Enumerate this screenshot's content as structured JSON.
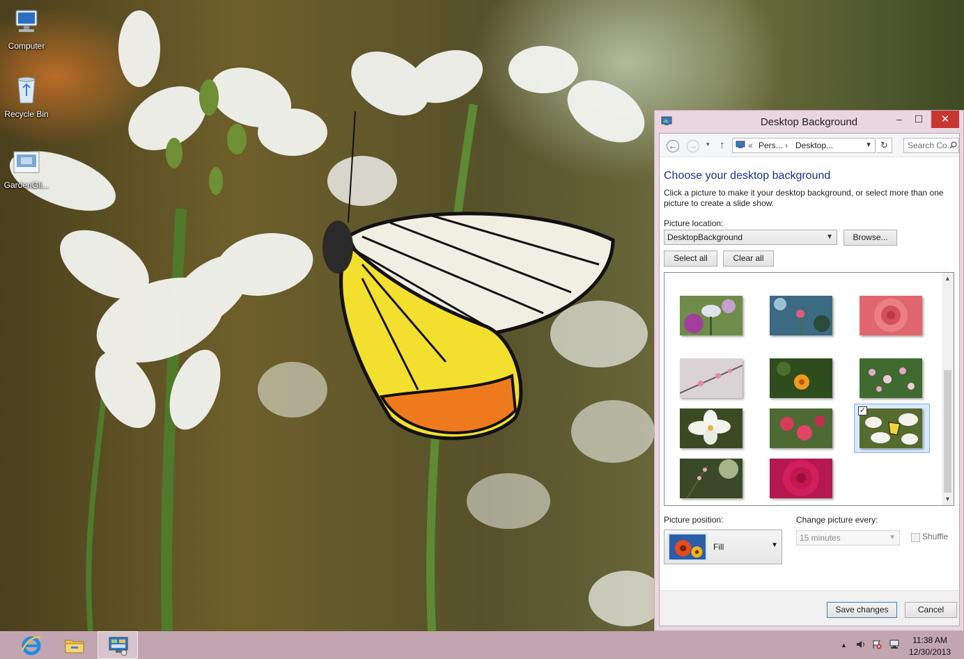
{
  "desktop": {
    "icons": [
      {
        "label": "Computer",
        "icon": "computer-icon"
      },
      {
        "label": "Recycle Bin",
        "icon": "recycle-bin-icon"
      },
      {
        "label": "GardenGli...",
        "icon": "theme-file-icon"
      }
    ]
  },
  "window": {
    "title": "Desktop Background",
    "controls": {
      "minimize": "–",
      "maximize": "☐",
      "close": "✕"
    },
    "nav": {
      "back": "←",
      "forward": "→",
      "recent": "▾",
      "up": "↑",
      "breadcrumb": [
        "Pers...",
        "Desktop..."
      ],
      "breadcrumb_sep": "«",
      "crumb_arrow": "›",
      "search_placeholder": "Search Co...",
      "refresh": "↻"
    },
    "heading": "Choose your desktop background",
    "description": "Click a picture to make it your desktop background, or select more than one picture to create a slide show.",
    "picture_location": {
      "label": "Picture location:",
      "value": "DesktopBackground",
      "browse_label": "Browse..."
    },
    "select_all_label": "Select all",
    "clear_all_label": "Clear all",
    "gallery": {
      "thumbnails": [
        {
          "subject": "butterfly on purple flowers",
          "selected": false
        },
        {
          "subject": "pink flower on blue bokeh",
          "selected": false
        },
        {
          "subject": "pink rose",
          "selected": false
        },
        {
          "subject": "branch with pink blossoms",
          "selected": false
        },
        {
          "subject": "orange flower on green",
          "selected": false
        },
        {
          "subject": "pink wildflowers",
          "selected": false
        },
        {
          "subject": "white lily",
          "selected": false
        },
        {
          "subject": "red gerbera flowers",
          "selected": false
        },
        {
          "subject": "butterfly on white flowers",
          "selected": true
        },
        {
          "subject": "small pink blossoms",
          "selected": false
        },
        {
          "subject": "magenta dahlia",
          "selected": false
        }
      ],
      "scroll_position": 0.55
    },
    "picture_position": {
      "label": "Picture position:",
      "value": "Fill"
    },
    "change_picture": {
      "label": "Change picture every:",
      "value": "15 minutes",
      "enabled": false
    },
    "shuffle": {
      "label": "Shuffle",
      "checked": false,
      "enabled": false
    },
    "save_label": "Save changes",
    "cancel_label": "Cancel"
  },
  "taskbar": {
    "apps": [
      {
        "name": "internet-explorer-icon",
        "active": false
      },
      {
        "name": "file-explorer-icon",
        "active": false
      },
      {
        "name": "control-panel-icon",
        "active": true
      }
    ],
    "tray": {
      "chevron": "▲"
    },
    "clock": {
      "time": "11:38 AM",
      "date": "12/30/2013"
    }
  },
  "colors": {
    "heading_blue": "#1e3287",
    "window_frame": "#ead6e0",
    "close_red": "#c7372f",
    "taskbar": "#cdafbe"
  }
}
